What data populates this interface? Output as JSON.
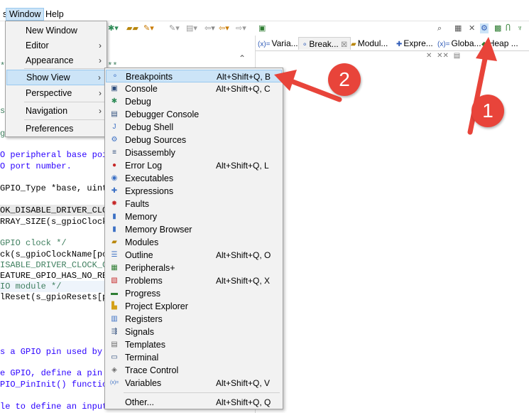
{
  "menubar": {
    "items": [
      {
        "label": "s"
      },
      {
        "label": "Window"
      },
      {
        "label": "Help"
      }
    ]
  },
  "window_menu": {
    "items": [
      {
        "label": "New Window",
        "has_submenu": false
      },
      {
        "label": "Editor",
        "has_submenu": true
      },
      {
        "label": "Appearance",
        "has_submenu": true
      },
      {
        "label": "Show View",
        "has_submenu": true
      },
      {
        "label": "Perspective",
        "has_submenu": true
      },
      {
        "label": "Navigation",
        "has_submenu": true
      },
      {
        "label": "Preferences",
        "has_submenu": false
      }
    ],
    "arrow_glyph": "›"
  },
  "show_view_menu": {
    "items": [
      {
        "label": "Breakpoints",
        "shortcut": "Alt+Shift+Q, B",
        "icon": "breakpoints-icon",
        "glyph": "⚬",
        "color": "#3a6fc4"
      },
      {
        "label": "Console",
        "shortcut": "Alt+Shift+Q, C",
        "icon": "console-icon",
        "glyph": "▣",
        "color": "#2b4a7a"
      },
      {
        "label": "Debug",
        "shortcut": "",
        "icon": "debug-icon",
        "glyph": "✱",
        "color": "#2e8b57"
      },
      {
        "label": "Debugger Console",
        "shortcut": "",
        "icon": "debugger-console-icon",
        "glyph": "▤",
        "color": "#2b4a7a"
      },
      {
        "label": "Debug Shell",
        "shortcut": "",
        "icon": "debug-shell-icon",
        "glyph": "J",
        "color": "#3a6fc4"
      },
      {
        "label": "Debug Sources",
        "shortcut": "",
        "icon": "debug-sources-icon",
        "glyph": "⚙",
        "color": "#3a6fc4"
      },
      {
        "label": "Disassembly",
        "shortcut": "",
        "icon": "disassembly-icon",
        "glyph": "≡",
        "color": "#2b4a7a"
      },
      {
        "label": "Error Log",
        "shortcut": "Alt+Shift+Q, L",
        "icon": "error-log-icon",
        "glyph": "●",
        "color": "#c62828"
      },
      {
        "label": "Executables",
        "shortcut": "",
        "icon": "executables-icon",
        "glyph": "◉",
        "color": "#3a6fc4"
      },
      {
        "label": "Expressions",
        "shortcut": "",
        "icon": "expressions-icon",
        "glyph": "✚",
        "color": "#3a6fc4"
      },
      {
        "label": "Faults",
        "shortcut": "",
        "icon": "faults-icon",
        "glyph": "✸",
        "color": "#c62828"
      },
      {
        "label": "Memory",
        "shortcut": "",
        "icon": "memory-icon",
        "glyph": "▮",
        "color": "#3a6fc4"
      },
      {
        "label": "Memory Browser",
        "shortcut": "",
        "icon": "memory-browser-icon",
        "glyph": "▮",
        "color": "#3a6fc4"
      },
      {
        "label": "Modules",
        "shortcut": "",
        "icon": "modules-icon",
        "glyph": "▰",
        "color": "#b8860b"
      },
      {
        "label": "Outline",
        "shortcut": "Alt+Shift+Q, O",
        "icon": "outline-icon",
        "glyph": "☰",
        "color": "#3a6fc4"
      },
      {
        "label": "Peripherals+",
        "shortcut": "",
        "icon": "peripherals-icon",
        "glyph": "▦",
        "color": "#2e7d32"
      },
      {
        "label": "Problems",
        "shortcut": "Alt+Shift+Q, X",
        "icon": "problems-icon",
        "glyph": "▧",
        "color": "#c62828"
      },
      {
        "label": "Progress",
        "shortcut": "",
        "icon": "progress-icon",
        "glyph": "▬",
        "color": "#2e7d32"
      },
      {
        "label": "Project Explorer",
        "shortcut": "",
        "icon": "project-explorer-icon",
        "glyph": "▙",
        "color": "#d4a017"
      },
      {
        "label": "Registers",
        "shortcut": "",
        "icon": "registers-icon",
        "glyph": "▥",
        "color": "#3a6fc4"
      },
      {
        "label": "Signals",
        "shortcut": "",
        "icon": "signals-icon",
        "glyph": "⇶",
        "color": "#2b4a7a"
      },
      {
        "label": "Templates",
        "shortcut": "",
        "icon": "templates-icon",
        "glyph": "▤",
        "color": "#6d6d6d"
      },
      {
        "label": "Terminal",
        "shortcut": "",
        "icon": "terminal-icon",
        "glyph": "▭",
        "color": "#2b4a7a"
      },
      {
        "label": "Trace Control",
        "shortcut": "",
        "icon": "trace-control-icon",
        "glyph": "◈",
        "color": "#6d6d6d"
      },
      {
        "label": "Variables",
        "shortcut": "Alt+Shift+Q, V",
        "icon": "variables-icon",
        "glyph": "(x)=",
        "color": "#3a6fc4"
      }
    ],
    "other": {
      "label": "Other...",
      "shortcut": "Alt+Shift+Q, Q"
    }
  },
  "view_tabs": [
    {
      "label": "Varia...",
      "icon": "variables-tab-icon",
      "glyph": "(x)="
    },
    {
      "label": "Break...",
      "icon": "breakpoints-tab-icon",
      "glyph": "⚬",
      "close": "☒",
      "active": true
    },
    {
      "label": "Modul...",
      "icon": "modules-tab-icon",
      "glyph": "▰"
    },
    {
      "label": "Expre...",
      "icon": "expressions-tab-icon",
      "glyph": "✚"
    },
    {
      "label": "Globa...",
      "icon": "globals-tab-icon",
      "glyph": "(x)="
    },
    {
      "label": "Heap ...",
      "icon": "heap-tab-icon",
      "glyph": "◆"
    }
  ],
  "editor": {
    "lines": [
      {
        "text": "***********************",
        "style": "green"
      },
      {
        "text": "s",
        "style": "green"
      },
      {
        "text": "ge",
        "style": "green"
      },
      {
        "text": "O peripheral base poi",
        "style": "blue"
      },
      {
        "text": "O port number.",
        "style": "blue"
      },
      {
        "text": "GPIO_Type *base, uint",
        "style": "normal"
      },
      {
        "text": "OK_DISABLE_DRIVER_CLOC",
        "style": "hl"
      },
      {
        "text": "RRAY_SIZE(s_gpioClock",
        "style": "normal"
      },
      {
        "text": "GPIO clock */",
        "style": "green"
      },
      {
        "text": "ck(s_gpioClockName[po",
        "style": "normal"
      },
      {
        "text": "ISABLE_DRIVER_CLOCK_C",
        "style": "green"
      },
      {
        "text": "EATURE_GPIO_HAS_NO_RE",
        "style": "normal"
      },
      {
        "text": "IO module */",
        "style": "hl2"
      },
      {
        "text": "lReset(s_gpioResets[p",
        "style": "normal"
      },
      {
        "text": "s a GPIO pin used by",
        "style": "blue"
      },
      {
        "text": "e GPIO, define a pin",
        "style": "blue"
      },
      {
        "text": "PIO_PinInit() functio",
        "style": "blue"
      },
      {
        "text": "le to define an input",
        "style": "blue"
      }
    ]
  },
  "callouts": [
    {
      "number": "1"
    },
    {
      "number": "2"
    }
  ],
  "colors": {
    "highlight": "#cce4f7",
    "callout": "#e8443a"
  }
}
